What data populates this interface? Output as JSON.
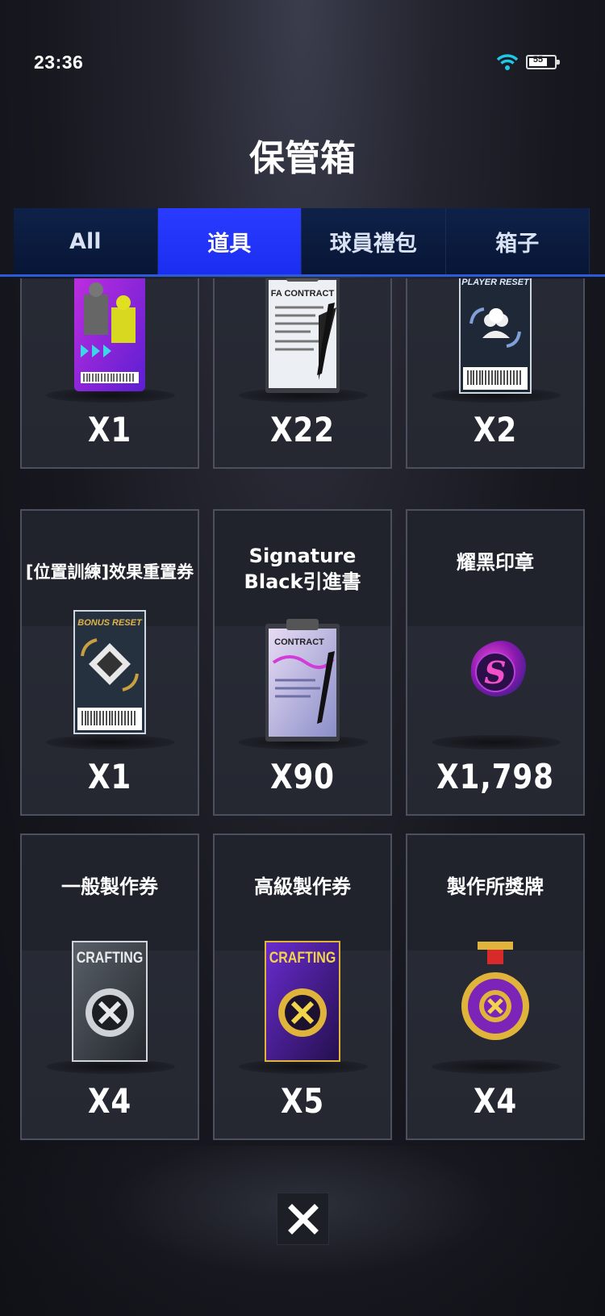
{
  "status": {
    "time": "23:36",
    "battery": "55"
  },
  "header": {
    "title": "保管箱"
  },
  "tabs": [
    {
      "label": "All",
      "active": false
    },
    {
      "label": "道具",
      "active": true
    },
    {
      "label": "球員禮包",
      "active": false
    },
    {
      "label": "箱子",
      "active": false
    }
  ],
  "items": [
    {
      "title": "",
      "qty": "X1",
      "icon": "player-swap-ticket-icon"
    },
    {
      "title": "",
      "qty": "X22",
      "icon": "fa-contract-icon",
      "art_text": "FA CONTRACT"
    },
    {
      "title": "",
      "qty": "X2",
      "icon": "player-reset-ticket-icon",
      "art_text": "PLAYER RESET"
    },
    {
      "title": "[位置訓練]效果重置券",
      "qty": "X1",
      "icon": "bonus-reset-ticket-icon",
      "art_text": "BONUS RESET"
    },
    {
      "title_line1": "Signature",
      "title_line2": "Black引進書",
      "qty": "X90",
      "icon": "signature-contract-icon",
      "art_text": "CONTRACT"
    },
    {
      "title": "耀黑印章",
      "qty": "X1,798",
      "icon": "black-seal-icon"
    },
    {
      "title": "一般製作券",
      "qty": "X4",
      "icon": "crafting-ticket-icon",
      "art_text": "CRAFTING"
    },
    {
      "title": "高級製作券",
      "qty": "X5",
      "icon": "premium-crafting-ticket-icon",
      "art_text": "CRAFTING"
    },
    {
      "title": "製作所獎牌",
      "qty": "X4",
      "icon": "crafting-medal-icon"
    }
  ],
  "colors": {
    "active_tab": "#1f33ff",
    "tab_bg": "#0b1b40",
    "card_border": "#4a505e"
  }
}
